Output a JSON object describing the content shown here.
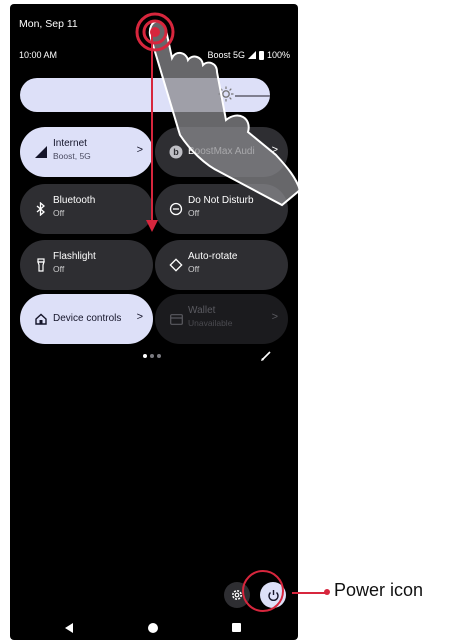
{
  "status_bar": {
    "date": "Mon, Sep 11",
    "time": "10:00 AM",
    "carrier": "Boost 5G",
    "battery": "100%"
  },
  "brightness": {
    "icon": "brightness-icon",
    "level": 0.9
  },
  "tiles": [
    {
      "label": "Internet",
      "sub": "Boost, 5G",
      "icon": "signal-icon",
      "state": "active",
      "chevron": ">"
    },
    {
      "label": "BoostMax Audi",
      "sub": "",
      "icon": "bluetooth-device-icon",
      "state": "inactive",
      "chevron": ">"
    },
    {
      "label": "Bluetooth",
      "sub": "Off",
      "icon": "bluetooth-icon",
      "state": "inactive"
    },
    {
      "label": "Do Not Disturb",
      "sub": "Off",
      "icon": "dnd-icon",
      "state": "inactive"
    },
    {
      "label": "Flashlight",
      "sub": "Off",
      "icon": "flashlight-icon",
      "state": "inactive"
    },
    {
      "label": "Auto-rotate",
      "sub": "Off",
      "icon": "rotate-icon",
      "state": "inactive"
    },
    {
      "label": "Device controls",
      "sub": "",
      "icon": "home-icon",
      "state": "active",
      "chevron": ">"
    },
    {
      "label": "Wallet",
      "sub": "Unavailable",
      "icon": "wallet-icon",
      "state": "disabled",
      "chevron": ">"
    }
  ],
  "pager": {
    "pages": 3,
    "current": 1
  },
  "bottom_buttons": {
    "settings_icon": "gear-icon",
    "power_icon": "power-icon"
  },
  "callout": {
    "label": "Power icon"
  },
  "colors": {
    "accent": "#dde0f8",
    "annotation": "#d7263d",
    "tile_dark": "#2e2e32"
  }
}
